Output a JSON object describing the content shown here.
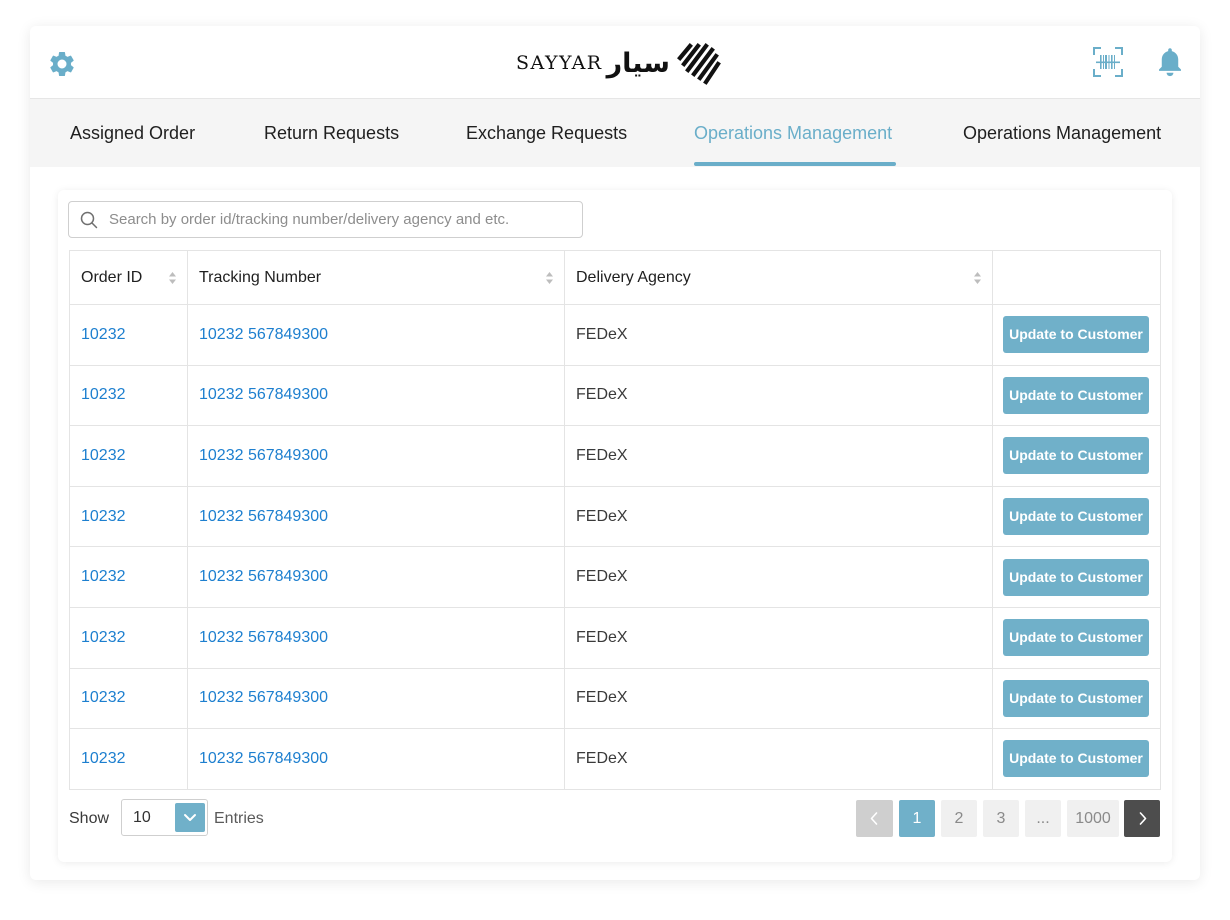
{
  "header": {
    "brand_latin": "SAYYAR",
    "brand_arabic": "سيار",
    "icons": {
      "settings": "gear-icon",
      "scan": "barcode-scan-icon",
      "notifications": "bell-icon"
    },
    "colors": {
      "accent": "#70b0c9",
      "link": "#1d7fcf",
      "icon": "#6aaec9"
    }
  },
  "tabs": [
    {
      "label": "Assigned Order",
      "active": false
    },
    {
      "label": "Return Requests",
      "active": false
    },
    {
      "label": "Exchange Requests",
      "active": false
    },
    {
      "label": "Operations Management",
      "active": true
    },
    {
      "label": "Operations Management",
      "active": false
    }
  ],
  "search": {
    "placeholder": "Search by order id/tracking number/delivery agency and etc.",
    "value": ""
  },
  "table": {
    "columns": [
      "Order ID",
      "Tracking Number",
      "Delivery Agency",
      ""
    ],
    "rows": [
      {
        "order_id": "10232",
        "tracking": "10232 567849300",
        "agency": "FEDeX",
        "action": "Update to Customer"
      },
      {
        "order_id": "10232",
        "tracking": "10232 567849300",
        "agency": "FEDeX",
        "action": "Update to Customer"
      },
      {
        "order_id": "10232",
        "tracking": "10232 567849300",
        "agency": "FEDeX",
        "action": "Update to Customer"
      },
      {
        "order_id": "10232",
        "tracking": "10232 567849300",
        "agency": "FEDeX",
        "action": "Update to Customer"
      },
      {
        "order_id": "10232",
        "tracking": "10232 567849300",
        "agency": "FEDeX",
        "action": "Update to Customer"
      },
      {
        "order_id": "10232",
        "tracking": "10232 567849300",
        "agency": "FEDeX",
        "action": "Update to Customer"
      },
      {
        "order_id": "10232",
        "tracking": "10232 567849300",
        "agency": "FEDeX",
        "action": "Update to Customer"
      },
      {
        "order_id": "10232",
        "tracking": "10232 567849300",
        "agency": "FEDeX",
        "action": "Update to Customer"
      }
    ]
  },
  "footer": {
    "show_label": "Show",
    "entries_value": "10",
    "entries_label": "Entries",
    "pages": [
      "1",
      "2",
      "3",
      "...",
      "1000"
    ],
    "current_page": "1"
  }
}
